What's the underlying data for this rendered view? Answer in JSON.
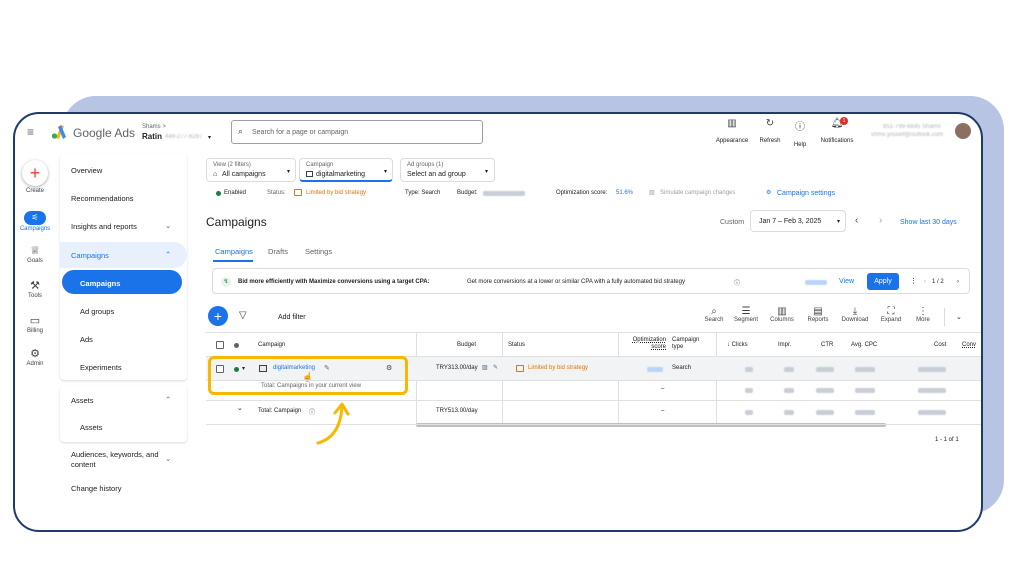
{
  "brand": {
    "name": "Google Ads",
    "account_label": "Shams >",
    "account_name": "Ratin",
    "account_id": "449-277-6287"
  },
  "search": {
    "placeholder": "Search for a page or campaign"
  },
  "top_actions": [
    {
      "label": "Appearance",
      "icon": "appearance-icon"
    },
    {
      "label": "Refresh",
      "icon": "refresh-icon"
    },
    {
      "label": "Help",
      "icon": "help-icon"
    },
    {
      "label": "Notifications",
      "icon": "bell-icon",
      "badge": "1"
    }
  ],
  "user": {
    "line1": "851-799-6845 Shams",
    "line2": "shms.yousef@outlook.com"
  },
  "rail": [
    {
      "label": "Create",
      "icon": "plus-icon"
    },
    {
      "label": "Campaigns",
      "icon": "campaigns-icon"
    },
    {
      "label": "Goals",
      "icon": "trophy-icon"
    },
    {
      "label": "Tools",
      "icon": "tools-icon"
    },
    {
      "label": "Billing",
      "icon": "billing-icon"
    },
    {
      "label": "Admin",
      "icon": "admin-gear-icon"
    }
  ],
  "sidebar": {
    "overview": "Overview",
    "recommendations": "Recommendations",
    "insights": "Insights and reports",
    "campaigns_group": "Campaigns",
    "campaigns": "Campaigns",
    "ad_groups": "Ad groups",
    "ads": "Ads",
    "experiments": "Experiments",
    "assets_group": "Assets",
    "assets": "Assets",
    "audiences": "Audiences, keywords, and content",
    "change_history": "Change history"
  },
  "filters": {
    "view_label": "View (2 filters)",
    "view_value": "All campaigns",
    "campaign_label": "Campaign",
    "campaign_value": "digitalmarketing",
    "adgroup_label": "Ad groups (1)",
    "adgroup_value": "Select an ad group"
  },
  "status_bar": {
    "enabled": "Enabled",
    "status_label": "Status:",
    "status_value": "Limited by bid strategy",
    "type": "Type: Search",
    "budget_label": "Budget:",
    "opt_label": "Optimization score:",
    "opt_value": "51.6%",
    "simulate": "Simulate campaign changes",
    "settings": "Campaign settings"
  },
  "page": {
    "title": "Campaigns",
    "custom": "Custom",
    "date_range": "Jan 7 – Feb 3, 2025",
    "show_last": "Show last 30 days"
  },
  "tabs": [
    "Campaigns",
    "Drafts",
    "Settings"
  ],
  "reco": {
    "bold": "Bid more efficiently with Maximize conversions using a target CPA:",
    "text": "Get more conversions at a lower or similar CPA with a fully automated bid strategy",
    "view": "View",
    "apply": "Apply",
    "pager": "1 / 2"
  },
  "toolbar": {
    "add_filter": "Add filter",
    "tools": [
      "Search",
      "Segment",
      "Columns",
      "Reports",
      "Download",
      "Expand",
      "More"
    ]
  },
  "table": {
    "headers": {
      "campaign": "Campaign",
      "budget": "Budget",
      "status": "Status",
      "opt_score": "Optimization score",
      "campaign_type": "Campaign type",
      "clicks": "↓ Clicks",
      "impr": "Impr.",
      "ctr": "CTR",
      "avg_cpc": "Avg. CPC",
      "cost": "Cost",
      "conv": "Conv"
    },
    "row": {
      "name": "digitalmarketing",
      "budget": "TRY313.00/day",
      "status": "Limited by bid strategy",
      "type": "Search"
    },
    "subtotal_label": "Total: Campaigns in your current view",
    "subtotal_opt": "–",
    "total_label": "Total: Campaign",
    "total_budget": "TRY513.00/day",
    "total_opt": "–",
    "pagination": "1 - 1 of 1"
  },
  "colors": {
    "accent": "#1a73e8",
    "highlight": "#f9b800",
    "warning": "#e37400",
    "green": "#188038"
  }
}
